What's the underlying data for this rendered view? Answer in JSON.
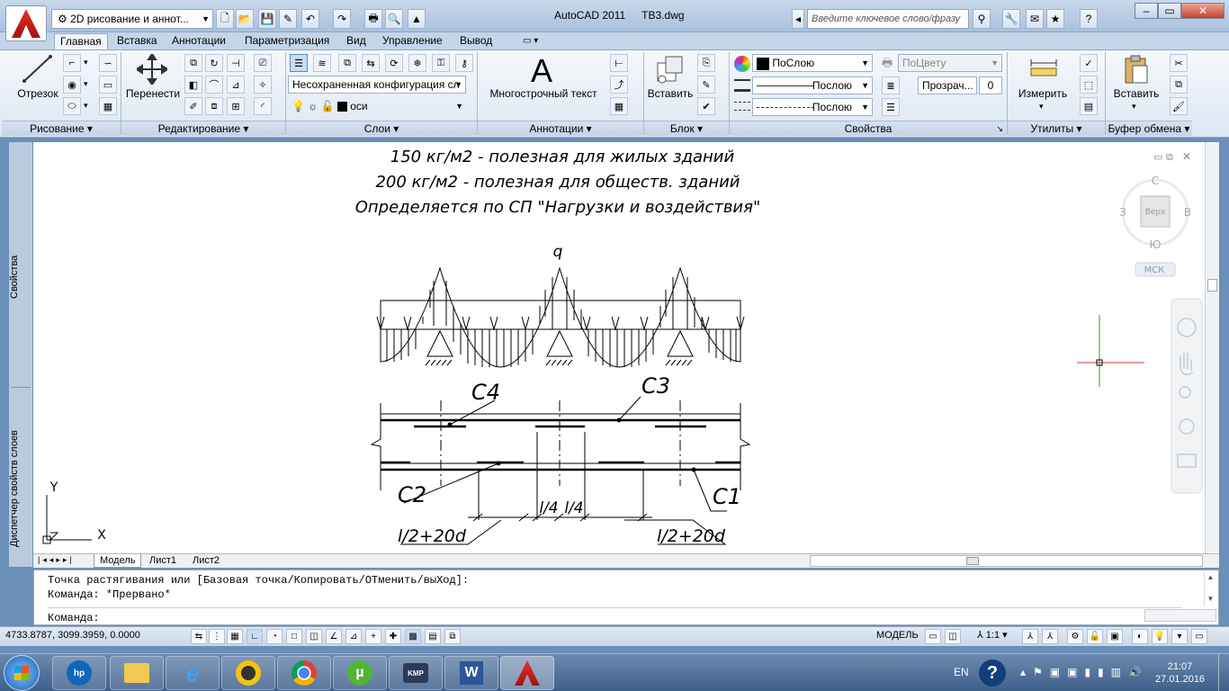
{
  "window": {
    "title": "AutoCAD 2011",
    "filename": "TB3.dwg",
    "workspace": "2D рисование и аннот...",
    "search_placeholder": "Введите ключевое слово/фразу"
  },
  "tabs": [
    "Главная",
    "Вставка",
    "Аннотации",
    "Параметризация",
    "Вид",
    "Управление",
    "Вывод"
  ],
  "ribbon": {
    "draw": {
      "line": "Отрезок",
      "label": "Рисование"
    },
    "modify": {
      "move": "Перенести",
      "label": "Редактирование"
    },
    "layers": {
      "config": "Несохраненная конфигурация сл",
      "current": "оси",
      "label": "Слои"
    },
    "annotation": {
      "mtext": "Многострочный текст",
      "label": "Аннотации"
    },
    "block": {
      "insert": "Вставить",
      "label": "Блок"
    },
    "properties": {
      "color": "ПоСлою",
      "plot": "ПоЦвету",
      "lineweight": "Послою",
      "linetype": "Послою",
      "transparency": "Прозрач...",
      "transparency_value": "0",
      "label": "Свойства"
    },
    "utilities": {
      "measure": "Измерить",
      "label": "Утилиты"
    },
    "clipboard": {
      "paste": "Вставить",
      "label": "Буфер обмена"
    }
  },
  "side_panels": {
    "properties": "Свойства",
    "layers": "Диспетчер свойств слоев"
  },
  "drawing": {
    "notes": [
      "150 кг/м2 - полезная для жилых зданий",
      "200 кг/м2 - полезная для обществ. зданий",
      "Определяется по СП \"Нагрузки и воздействия\""
    ],
    "load": "q",
    "labels": {
      "c1": "C1",
      "c2": "C2",
      "c3": "C3",
      "c4": "C4",
      "l4a": "l/4",
      "l4b": "l/4",
      "anchor_left": "l/2+20d",
      "anchor_right": "l/2+20d"
    }
  },
  "viewcube": {
    "n": "С",
    "s": "Ю",
    "w": "З",
    "e": "В",
    "top": "Верх",
    "ucs": "МСК"
  },
  "ucs_icon": {
    "x": "X",
    "y": "Y"
  },
  "layout_tabs": [
    "Модель",
    "Лист1",
    "Лист2"
  ],
  "command": {
    "history": [
      "Точка растягивания или [Базовая точка/Копировать/ОТменить/выХод]:",
      "Команда: *Прервано*"
    ],
    "prompt": "Команда:"
  },
  "status": {
    "coords": "4733.8787, 3099.3959, 0.0000",
    "space": "МОДЕЛЬ",
    "scale": "1:1"
  },
  "taskbar": {
    "lang": "EN",
    "time": "21:07",
    "date": "27.01.2016",
    "apps": [
      "hp",
      "Explorer",
      "IE",
      "KMPlayer",
      "Chrome",
      "uTorrent",
      "KMP",
      "Word",
      "AutoCAD"
    ]
  }
}
